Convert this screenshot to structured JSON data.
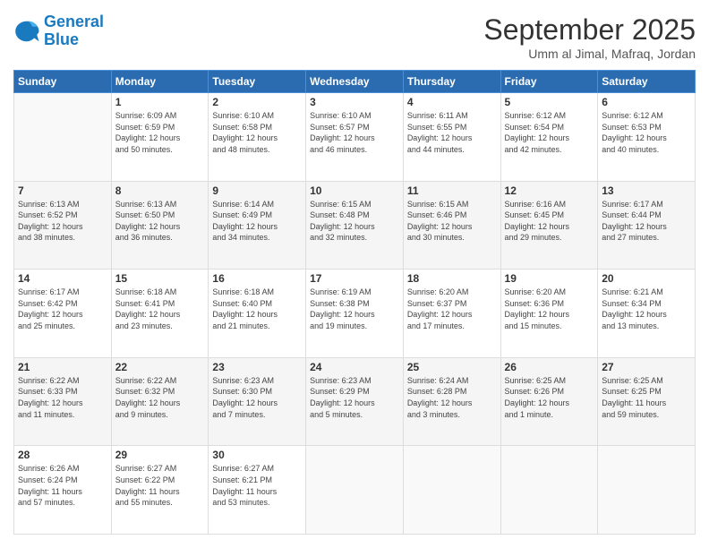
{
  "logo": {
    "line1": "General",
    "line2": "Blue"
  },
  "header": {
    "month": "September 2025",
    "location": "Umm al Jimal, Mafraq, Jordan"
  },
  "weekdays": [
    "Sunday",
    "Monday",
    "Tuesday",
    "Wednesday",
    "Thursday",
    "Friday",
    "Saturday"
  ],
  "weeks": [
    [
      {
        "day": "",
        "info": ""
      },
      {
        "day": "1",
        "info": "Sunrise: 6:09 AM\nSunset: 6:59 PM\nDaylight: 12 hours\nand 50 minutes."
      },
      {
        "day": "2",
        "info": "Sunrise: 6:10 AM\nSunset: 6:58 PM\nDaylight: 12 hours\nand 48 minutes."
      },
      {
        "day": "3",
        "info": "Sunrise: 6:10 AM\nSunset: 6:57 PM\nDaylight: 12 hours\nand 46 minutes."
      },
      {
        "day": "4",
        "info": "Sunrise: 6:11 AM\nSunset: 6:55 PM\nDaylight: 12 hours\nand 44 minutes."
      },
      {
        "day": "5",
        "info": "Sunrise: 6:12 AM\nSunset: 6:54 PM\nDaylight: 12 hours\nand 42 minutes."
      },
      {
        "day": "6",
        "info": "Sunrise: 6:12 AM\nSunset: 6:53 PM\nDaylight: 12 hours\nand 40 minutes."
      }
    ],
    [
      {
        "day": "7",
        "info": "Sunrise: 6:13 AM\nSunset: 6:52 PM\nDaylight: 12 hours\nand 38 minutes."
      },
      {
        "day": "8",
        "info": "Sunrise: 6:13 AM\nSunset: 6:50 PM\nDaylight: 12 hours\nand 36 minutes."
      },
      {
        "day": "9",
        "info": "Sunrise: 6:14 AM\nSunset: 6:49 PM\nDaylight: 12 hours\nand 34 minutes."
      },
      {
        "day": "10",
        "info": "Sunrise: 6:15 AM\nSunset: 6:48 PM\nDaylight: 12 hours\nand 32 minutes."
      },
      {
        "day": "11",
        "info": "Sunrise: 6:15 AM\nSunset: 6:46 PM\nDaylight: 12 hours\nand 30 minutes."
      },
      {
        "day": "12",
        "info": "Sunrise: 6:16 AM\nSunset: 6:45 PM\nDaylight: 12 hours\nand 29 minutes."
      },
      {
        "day": "13",
        "info": "Sunrise: 6:17 AM\nSunset: 6:44 PM\nDaylight: 12 hours\nand 27 minutes."
      }
    ],
    [
      {
        "day": "14",
        "info": "Sunrise: 6:17 AM\nSunset: 6:42 PM\nDaylight: 12 hours\nand 25 minutes."
      },
      {
        "day": "15",
        "info": "Sunrise: 6:18 AM\nSunset: 6:41 PM\nDaylight: 12 hours\nand 23 minutes."
      },
      {
        "day": "16",
        "info": "Sunrise: 6:18 AM\nSunset: 6:40 PM\nDaylight: 12 hours\nand 21 minutes."
      },
      {
        "day": "17",
        "info": "Sunrise: 6:19 AM\nSunset: 6:38 PM\nDaylight: 12 hours\nand 19 minutes."
      },
      {
        "day": "18",
        "info": "Sunrise: 6:20 AM\nSunset: 6:37 PM\nDaylight: 12 hours\nand 17 minutes."
      },
      {
        "day": "19",
        "info": "Sunrise: 6:20 AM\nSunset: 6:36 PM\nDaylight: 12 hours\nand 15 minutes."
      },
      {
        "day": "20",
        "info": "Sunrise: 6:21 AM\nSunset: 6:34 PM\nDaylight: 12 hours\nand 13 minutes."
      }
    ],
    [
      {
        "day": "21",
        "info": "Sunrise: 6:22 AM\nSunset: 6:33 PM\nDaylight: 12 hours\nand 11 minutes."
      },
      {
        "day": "22",
        "info": "Sunrise: 6:22 AM\nSunset: 6:32 PM\nDaylight: 12 hours\nand 9 minutes."
      },
      {
        "day": "23",
        "info": "Sunrise: 6:23 AM\nSunset: 6:30 PM\nDaylight: 12 hours\nand 7 minutes."
      },
      {
        "day": "24",
        "info": "Sunrise: 6:23 AM\nSunset: 6:29 PM\nDaylight: 12 hours\nand 5 minutes."
      },
      {
        "day": "25",
        "info": "Sunrise: 6:24 AM\nSunset: 6:28 PM\nDaylight: 12 hours\nand 3 minutes."
      },
      {
        "day": "26",
        "info": "Sunrise: 6:25 AM\nSunset: 6:26 PM\nDaylight: 12 hours\nand 1 minute."
      },
      {
        "day": "27",
        "info": "Sunrise: 6:25 AM\nSunset: 6:25 PM\nDaylight: 11 hours\nand 59 minutes."
      }
    ],
    [
      {
        "day": "28",
        "info": "Sunrise: 6:26 AM\nSunset: 6:24 PM\nDaylight: 11 hours\nand 57 minutes."
      },
      {
        "day": "29",
        "info": "Sunrise: 6:27 AM\nSunset: 6:22 PM\nDaylight: 11 hours\nand 55 minutes."
      },
      {
        "day": "30",
        "info": "Sunrise: 6:27 AM\nSunset: 6:21 PM\nDaylight: 11 hours\nand 53 minutes."
      },
      {
        "day": "",
        "info": ""
      },
      {
        "day": "",
        "info": ""
      },
      {
        "day": "",
        "info": ""
      },
      {
        "day": "",
        "info": ""
      }
    ]
  ]
}
